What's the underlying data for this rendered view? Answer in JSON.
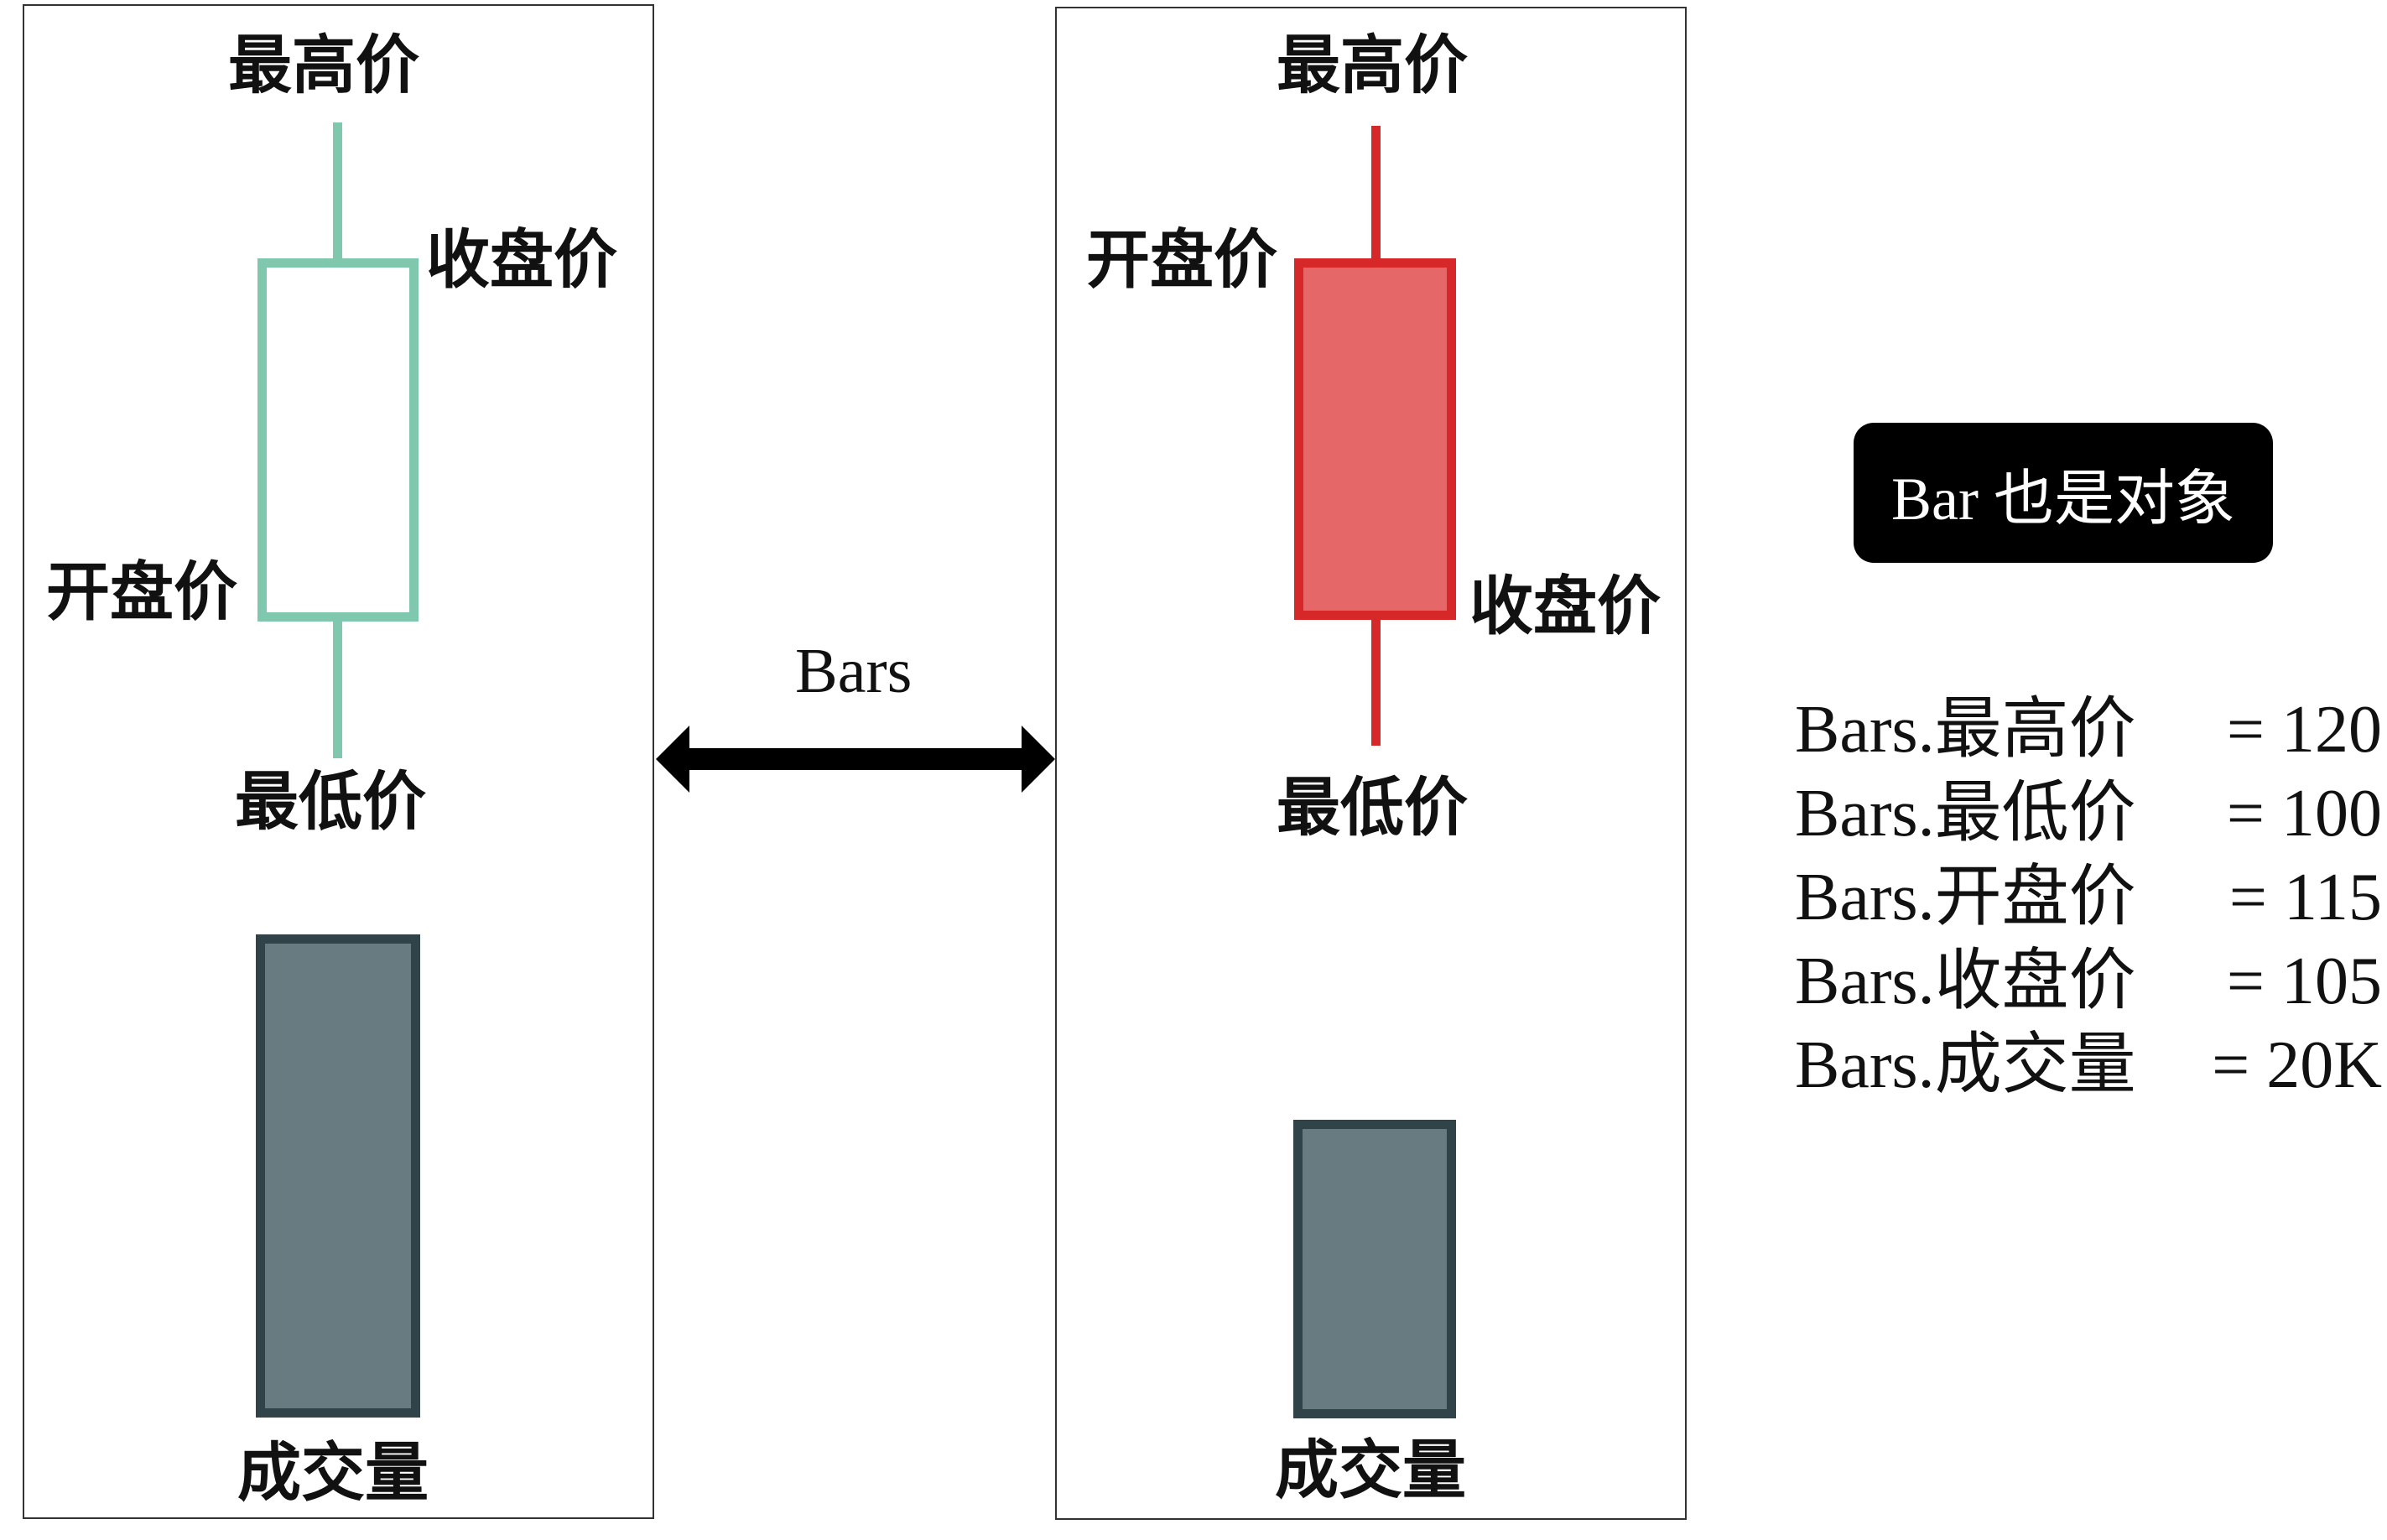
{
  "left_panel": {
    "high_label": "最高价",
    "close_label": "收盘价",
    "open_label": "开盘价",
    "low_label": "最低价",
    "volume_label": "成交量",
    "candle_color": "#7fc8ad"
  },
  "right_panel": {
    "high_label": "最高价",
    "open_label": "开盘价",
    "close_label": "收盘价",
    "low_label": "最低价",
    "volume_label": "成交量",
    "candle_fill": "#e56767",
    "candle_border": "#d62828"
  },
  "connector": {
    "label": "Bars",
    "icon": "double-arrow-icon"
  },
  "badge": {
    "text": "Bar 也是对象"
  },
  "formulas": [
    {
      "left": "Bars.最高价",
      "right": "= 120"
    },
    {
      "left": "Bars.最低价",
      "right": "= 100"
    },
    {
      "left": "Bars.开盘价",
      "right": "= 115"
    },
    {
      "left": "Bars.收盘价",
      "right": "= 105"
    },
    {
      "left": "Bars.成交量",
      "right": "= 20K"
    }
  ],
  "volume_color": "#677b80",
  "volume_border": "#2f4349"
}
